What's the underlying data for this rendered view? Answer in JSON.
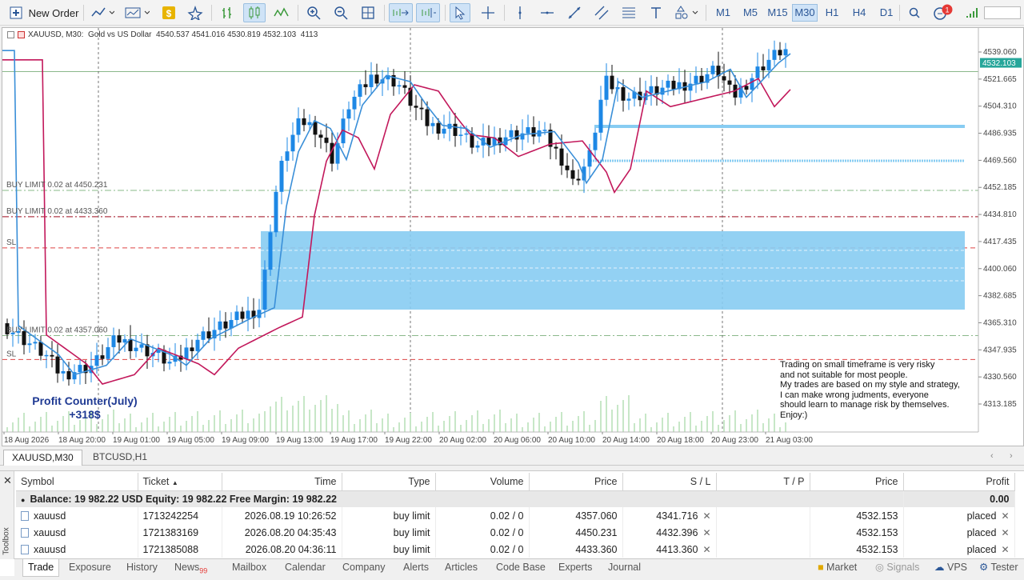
{
  "toolbar": {
    "new_order_label": "New Order",
    "timeframes": [
      "M1",
      "M5",
      "M15",
      "M30",
      "H1",
      "H4",
      "D1"
    ],
    "active_timeframe": "M30",
    "notification_count": "1"
  },
  "chart": {
    "header": "XAUUSD, M30:  Gold vs US Dollar  4540.537 4541.016 4530.819 4532.103  4113",
    "current_price": "4532.103",
    "price_ticks": [
      "4539.060",
      "4521.665",
      "4504.310",
      "4486.935",
      "4469.560",
      "4452.185",
      "4434.810",
      "4417.435",
      "4400.060",
      "4382.685",
      "4365.310",
      "4347.935",
      "4330.560",
      "4313.185"
    ],
    "time_ticks": [
      "18 Aug 2026",
      "18 Aug 20:00",
      "19 Aug 01:00",
      "19 Aug 05:00",
      "19 Aug 09:00",
      "19 Aug 13:00",
      "19 Aug 17:00",
      "19 Aug 22:00",
      "20 Aug 02:00",
      "20 Aug 06:00",
      "20 Aug 10:00",
      "20 Aug 14:00",
      "20 Aug 18:00",
      "20 Aug 23:00",
      "21 Aug 03:00"
    ],
    "order_labels": [
      "BUY LIMIT 0.02 at 4450.231",
      "BUY LIMIT 0.02 at 4433.360",
      "SL",
      "BUY LIMIT 0.02 at 4357.060",
      "SL"
    ],
    "profit_counter_title": "Profit Counter(July)",
    "profit_counter_value": "+318$",
    "disclaimer": [
      "Trading on small timeframe is very risky",
      "and not suitable for most people.",
      "My trades are based on my style and strategy,",
      "I can make wrong judments, everyone",
      "should learn to manage risk by themselves.",
      "Enjoy:)"
    ],
    "colors": {
      "bull": "#1e88e5",
      "bear": "#111111",
      "ma_fast": "#3a8fd8",
      "ma_slow": "#c2185b",
      "zone": "#87ccf2"
    }
  },
  "chart_tabs": [
    "XAUUSD,M30",
    "BTCUSD,H1"
  ],
  "orders": {
    "columns": [
      "Symbol",
      "Ticket",
      "Time",
      "Type",
      "Volume",
      "Price",
      "S / L",
      "T / P",
      "Price",
      "Profit"
    ],
    "balance_line": "Balance: 19 982.22 USD  Equity: 19 982.22  Free Margin: 19 982.22",
    "balance_profit": "0.00",
    "rows": [
      {
        "symbol": "xauusd",
        "ticket": "1713242254",
        "time": "2026.08.19 10:26:52",
        "type": "buy limit",
        "volume": "0.02 / 0",
        "price": "4357.060",
        "sl": "4341.716",
        "tp": "",
        "cur_price": "4532.153",
        "profit": "placed"
      },
      {
        "symbol": "xauusd",
        "ticket": "1721383169",
        "time": "2026.08.20 04:35:43",
        "type": "buy limit",
        "volume": "0.02 / 0",
        "price": "4450.231",
        "sl": "4432.396",
        "tp": "",
        "cur_price": "4532.153",
        "profit": "placed"
      },
      {
        "symbol": "xauusd",
        "ticket": "1721385088",
        "time": "2026.08.20 04:36:11",
        "type": "buy limit",
        "volume": "0.02 / 0",
        "price": "4433.360",
        "sl": "4413.360",
        "tp": "",
        "cur_price": "4532.153",
        "profit": "placed"
      }
    ]
  },
  "bottom_tabs": [
    "Trade",
    "Exposure",
    "History",
    "News",
    "Mailbox",
    "Calendar",
    "Company",
    "Alerts",
    "Articles",
    "Code Base",
    "Experts",
    "Journal"
  ],
  "news_badge": "99",
  "toolbox_label": "Toolbox",
  "status_right": [
    "Market",
    "Signals",
    "VPS",
    "Tester"
  ]
}
